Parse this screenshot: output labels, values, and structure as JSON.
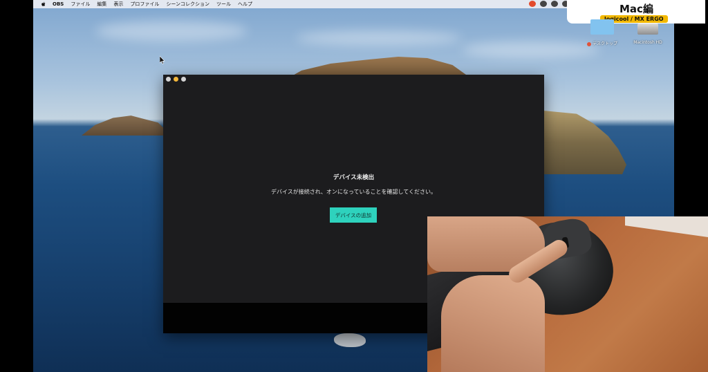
{
  "menubar": {
    "apple_icon": "apple-icon",
    "app_name": "OBS",
    "items": [
      "ファイル",
      "編集",
      "表示",
      "プロファイル",
      "シーンコレクション",
      "ツール",
      "ヘルプ"
    ]
  },
  "badge": {
    "title": "Mac編",
    "subtitle": "logicool / MX ERGO"
  },
  "desktop_icons": [
    {
      "label": "デスクトップ",
      "icon": "folder-icon",
      "tag_color": "#e0533a"
    },
    {
      "label": "Macintosh HD",
      "icon": "hard-drive-icon"
    }
  ],
  "window": {
    "heading": "デバイス未検出",
    "message": "デバイスが接続され、オンになっていることを確認してください。",
    "add_button_label": "デバイスの追加",
    "accent_color": "#2ed2bd"
  }
}
